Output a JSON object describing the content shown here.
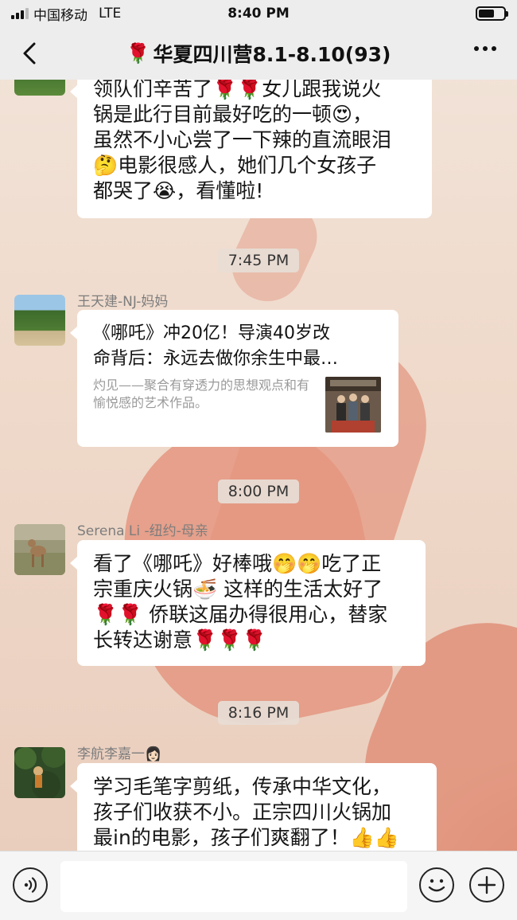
{
  "status_bar": {
    "carrier": "中国移动",
    "network": "LTE",
    "time": "8:40 PM"
  },
  "nav": {
    "title_emoji": "🌹",
    "title": "华夏四川营8.1-8.10(93)"
  },
  "messages": [
    {
      "type": "text",
      "lines": [
        "领队们辛苦了🌹🌹女儿跟我说火",
        "锅是此行目前最好吃的一顿😍，",
        "虽然不小心尝了一下辣的直流眼泪",
        "🤔电影很感人，她们几个女孩子",
        "都哭了😭，看懂啦!"
      ]
    },
    {
      "type": "timestamp",
      "text": "7:45 PM"
    },
    {
      "type": "link",
      "sender": "王天建-NJ-妈妈",
      "title_lines": [
        "《哪吒》冲20亿！导演40岁改",
        "命背后：永远去做你余生中最…"
      ],
      "desc": "灼见——聚合有穿透力的思想观点和有愉悦感的艺术作品。"
    },
    {
      "type": "timestamp",
      "text": "8:00 PM"
    },
    {
      "type": "text",
      "sender": "Serena Li -纽约-母亲",
      "lines": [
        "看了《哪吒》好棒哦🤭🤭吃了正",
        "宗重庆火锅🍜 这样的生活太好了",
        "🌹🌹 侨联这届办得很用心，替家",
        "长转达谢意🌹🌹🌹"
      ]
    },
    {
      "type": "timestamp",
      "text": "8:16 PM"
    },
    {
      "type": "text",
      "sender": "李航李嘉一👩🏻",
      "lines": [
        "学习毛笔字剪纸，传承中华文化，",
        "孩子们收获不小。正宗四川火锅加",
        "最in的电影，孩子们爽翻了！👍👍"
      ]
    }
  ],
  "input_bar": {
    "voice_icon": "voice-icon",
    "emoji_icon": "emoji-icon",
    "plus_icon": "plus-icon"
  },
  "colors": {
    "header_bg": "#ededed",
    "bubble_bg": "#ffffff",
    "sender_text": "#7d7d7d",
    "wallpaper_heart": "#e4967f"
  }
}
